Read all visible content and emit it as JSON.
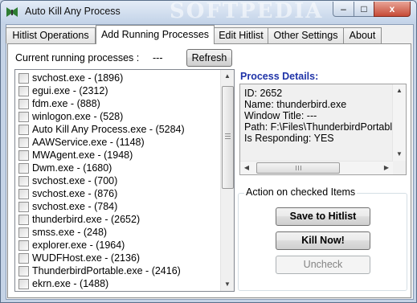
{
  "window": {
    "title": "Auto Kill Any Process",
    "watermark": "SOFTPEDIA",
    "controls": {
      "minimize": "–",
      "maximize": "□",
      "close": "x"
    }
  },
  "tabs": [
    {
      "label": "Hitlist Operations"
    },
    {
      "label": "Add Running Processes"
    },
    {
      "label": "Edit Hitlist"
    },
    {
      "label": "Other Settings"
    },
    {
      "label": "About"
    }
  ],
  "current": {
    "label": "Current running processes :",
    "value": "---"
  },
  "refresh_label": "Refresh",
  "processes": [
    "svchost.exe - (1896)",
    "egui.exe - (2312)",
    "fdm.exe - (888)",
    "winlogon.exe - (528)",
    "Auto Kill Any Process.exe - (5284)",
    "AAWService.exe - (1148)",
    "MWAgent.exe - (1948)",
    "Dwm.exe - (1680)",
    "svchost.exe - (700)",
    "svchost.exe - (876)",
    "svchost.exe - (784)",
    "thunderbird.exe - (2652)",
    "smss.exe - (248)",
    "explorer.exe - (1964)",
    "WUDFHost.exe - (2136)",
    "ThunderbirdPortable.exe - (2416)",
    "ekrn.exe - (1488)"
  ],
  "details": {
    "title": "Process Details:",
    "lines": [
      "ID: 2652",
      "Name: thunderbird.exe",
      "Window Title: ---",
      "Path: F:\\Files\\ThunderbirdPortable",
      "Is Responding: YES"
    ]
  },
  "actions": {
    "group_label": "Action on checked Items",
    "save": "Save to Hitlist",
    "kill": "Kill Now!",
    "uncheck": "Uncheck"
  },
  "colors": {
    "accent": "#1f33a8",
    "close_button": "#c64a36"
  }
}
